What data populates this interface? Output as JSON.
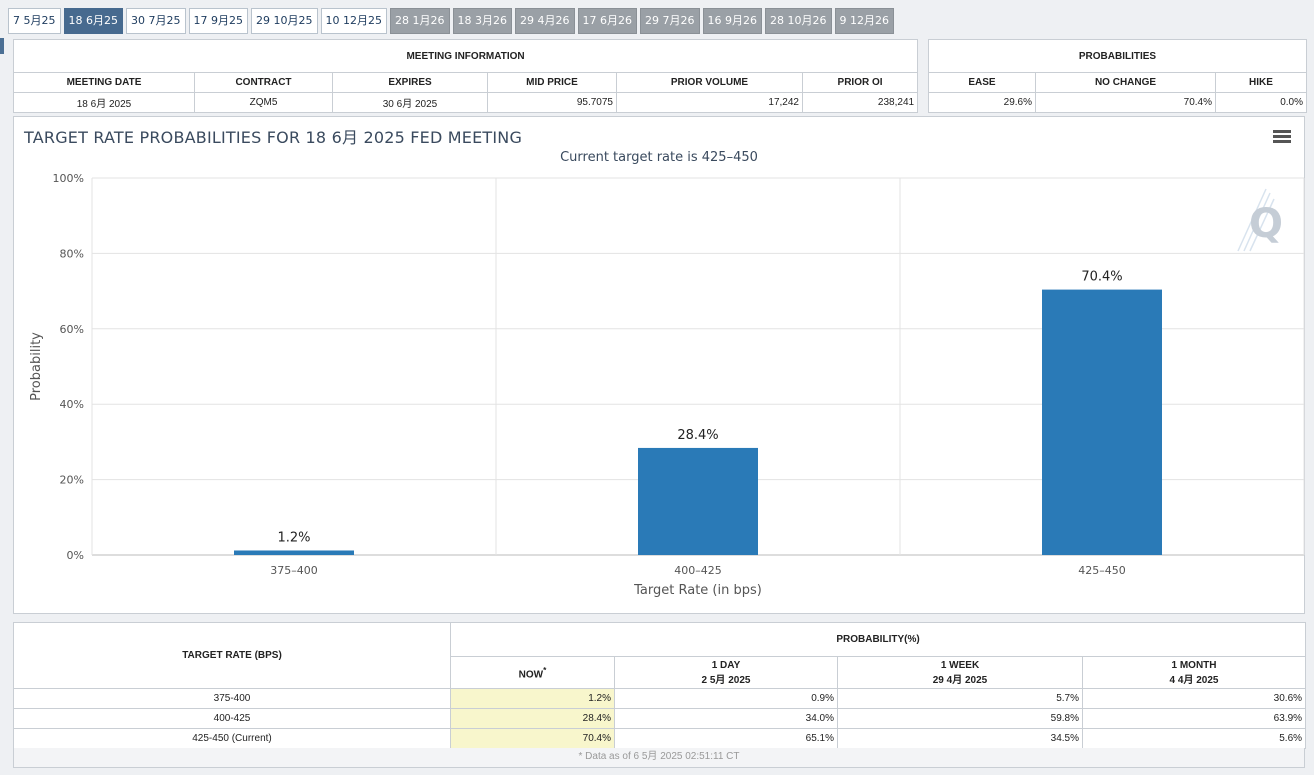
{
  "tabs": [
    {
      "label": "7 5月25",
      "state": "past"
    },
    {
      "label": "18 6月25",
      "state": "active"
    },
    {
      "label": "30 7月25",
      "state": "past"
    },
    {
      "label": "17 9月25",
      "state": "past"
    },
    {
      "label": "29 10月25",
      "state": "past"
    },
    {
      "label": "10 12月25",
      "state": "past"
    },
    {
      "label": "28 1月26",
      "state": "future"
    },
    {
      "label": "18 3月26",
      "state": "future"
    },
    {
      "label": "29 4月26",
      "state": "future"
    },
    {
      "label": "17 6月26",
      "state": "future"
    },
    {
      "label": "29 7月26",
      "state": "future"
    },
    {
      "label": "16 9月26",
      "state": "future"
    },
    {
      "label": "28 10月26",
      "state": "future"
    },
    {
      "label": "9 12月26",
      "state": "future"
    }
  ],
  "meeting_info": {
    "caption": "MEETING INFORMATION",
    "headers": {
      "meeting_date": "MEETING DATE",
      "contract": "CONTRACT",
      "expires": "EXPIRES",
      "mid_price": "MID PRICE",
      "prior_volume": "PRIOR VOLUME",
      "prior_oi": "PRIOR OI"
    },
    "values": {
      "meeting_date": "18 6月 2025",
      "contract": "ZQM5",
      "expires": "30 6月 2025",
      "mid_price": "95.7075",
      "prior_volume": "17,242",
      "prior_oi": "238,241"
    }
  },
  "probabilities": {
    "caption": "PROBABILITIES",
    "headers": {
      "ease": "EASE",
      "no_change": "NO CHANGE",
      "hike": "HIKE"
    },
    "values": {
      "ease": "29.6%",
      "no_change": "70.4%",
      "hike": "0.0%"
    }
  },
  "chart_data": {
    "type": "bar",
    "title": "TARGET RATE PROBABILITIES FOR 18 6月 2025 FED MEETING",
    "subtitle": "Current target rate is 425–450",
    "xlabel": "Target Rate (in bps)",
    "ylabel": "Probability",
    "categories": [
      "375–400",
      "400–425",
      "425–450"
    ],
    "values": [
      1.2,
      28.4,
      70.4
    ],
    "data_labels": [
      "1.2%",
      "28.4%",
      "70.4%"
    ],
    "ylim": [
      0,
      100
    ],
    "yticks": [
      0,
      20,
      40,
      60,
      80,
      100
    ],
    "ytick_labels": [
      "0%",
      "20%",
      "40%",
      "60%",
      "80%",
      "100%"
    ],
    "grid": true,
    "bar_color": "#2a7ab7"
  },
  "rate_table": {
    "col_target": "TARGET RATE (BPS)",
    "col_prob": "PROBABILITY(%)",
    "sub_headers": [
      {
        "line1": "NOW",
        "line2": ""
      },
      {
        "line1": "1 DAY",
        "line2": "2 5月 2025"
      },
      {
        "line1": "1 WEEK",
        "line2": "29 4月 2025"
      },
      {
        "line1": "1 MONTH",
        "line2": "4 4月 2025"
      }
    ],
    "now_marker": "*",
    "rows": [
      {
        "rate": "375-400",
        "now": "1.2%",
        "day": "0.9%",
        "week": "5.7%",
        "month": "30.6%"
      },
      {
        "rate": "400-425",
        "now": "28.4%",
        "day": "34.0%",
        "week": "59.8%",
        "month": "63.9%"
      },
      {
        "rate": "425-450 (Current)",
        "now": "70.4%",
        "day": "65.1%",
        "week": "34.5%",
        "month": "5.6%"
      }
    ],
    "footnote": "* Data as of 6 5月 2025 02:51:11 CT"
  },
  "icons": {
    "menu": "hamburger-menu-icon",
    "watermark": "quikstrike-logo"
  }
}
